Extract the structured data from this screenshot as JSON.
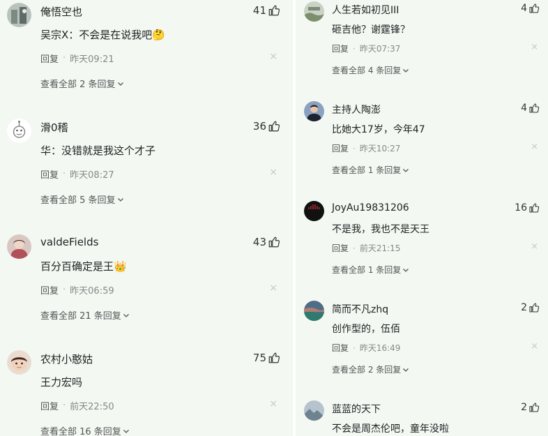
{
  "ui": {
    "reply_label": "回复",
    "close_glyph": "×",
    "dot": "·"
  },
  "left": [
    {
      "username": "俺悟空也",
      "likes": "41",
      "content": "吴宗X：不会是在说我吧🤔",
      "time": "昨天09:21",
      "view_all": "查看全部 2 条回复"
    },
    {
      "username": "滑0稽",
      "likes": "36",
      "content": "华：没错就是我这个才子",
      "time": "昨天08:27",
      "view_all": "查看全部 5 条回复"
    },
    {
      "username": "valdeFields",
      "likes": "43",
      "content": "百分百确定是王👑",
      "time": "昨天06:59",
      "view_all": "查看全部 21 条回复"
    },
    {
      "username": "农村小憨姑",
      "likes": "75",
      "content": "王力宏吗",
      "time": "前天22:50",
      "view_all": "查看全部 16 条回复"
    }
  ],
  "right": [
    {
      "username": "人生若如初见III",
      "likes": "4",
      "content": "砸吉他？谢霆锋？",
      "time": "昨天07:37",
      "view_all": "查看全部 4 条回复"
    },
    {
      "username": "主持人陶澎",
      "likes": "4",
      "content": "比她大17岁，今年47",
      "time": "昨天10:27",
      "view_all": "查看全部 1 条回复"
    },
    {
      "username": "JoyAu19831206",
      "likes": "16",
      "content": "不是我，我也不是天王",
      "time": "前天21:15",
      "view_all": "查看全部 1 条回复"
    },
    {
      "username": "简而不凡zhq",
      "likes": "2",
      "content": "创作型的，伍佰",
      "time": "昨天16:49",
      "view_all": "查看全部 2 条回复"
    },
    {
      "username": "蓝蓝的天下",
      "likes": "2",
      "content": "不会是周杰伦吧，童年没啦",
      "time": "",
      "view_all": ""
    }
  ]
}
